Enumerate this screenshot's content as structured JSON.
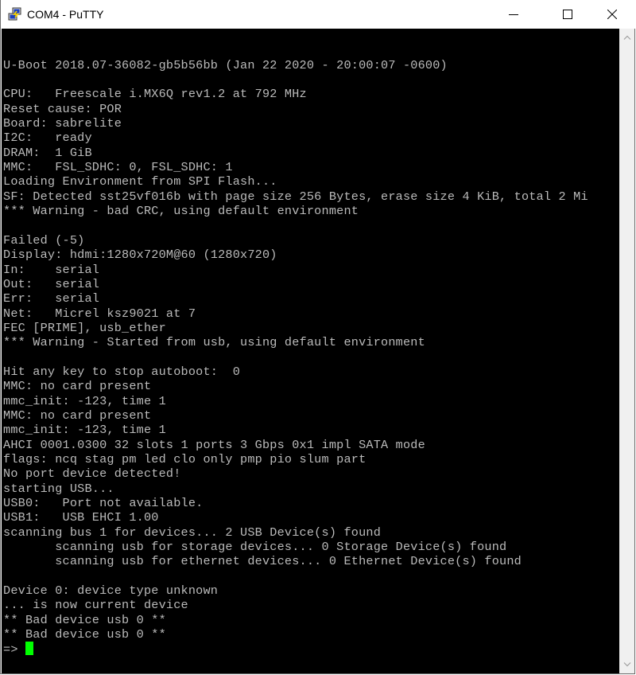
{
  "window": {
    "title": "COM4 - PuTTY",
    "app_icon": "putty-icon",
    "controls": {
      "minimize": "minimize-icon",
      "maximize": "maximize-icon",
      "close": "close-icon"
    }
  },
  "terminal": {
    "background": "#000000",
    "foreground": "#bbbbbb",
    "cursor_color": "#00ff00",
    "lines": [
      "",
      "",
      "U-Boot 2018.07-36082-gb5b56bb (Jan 22 2020 - 20:00:07 -0600)",
      "",
      "CPU:   Freescale i.MX6Q rev1.2 at 792 MHz",
      "Reset cause: POR",
      "Board: sabrelite",
      "I2C:   ready",
      "DRAM:  1 GiB",
      "MMC:   FSL_SDHC: 0, FSL_SDHC: 1",
      "Loading Environment from SPI Flash...",
      "SF: Detected sst25vf016b with page size 256 Bytes, erase size 4 KiB, total 2 Mi",
      "*** Warning - bad CRC, using default environment",
      "",
      "Failed (-5)",
      "Display: hdmi:1280x720M@60 (1280x720)",
      "In:    serial",
      "Out:   serial",
      "Err:   serial",
      "Net:   Micrel ksz9021 at 7",
      "FEC [PRIME], usb_ether",
      "*** Warning - Started from usb, using default environment",
      "",
      "Hit any key to stop autoboot:  0",
      "MMC: no card present",
      "mmc_init: -123, time 1",
      "MMC: no card present",
      "mmc_init: -123, time 1",
      "AHCI 0001.0300 32 slots 1 ports 3 Gbps 0x1 impl SATA mode",
      "flags: ncq stag pm led clo only pmp pio slum part",
      "No port device detected!",
      "starting USB...",
      "USB0:   Port not available.",
      "USB1:   USB EHCI 1.00",
      "scanning bus 1 for devices... 2 USB Device(s) found",
      "       scanning usb for storage devices... 0 Storage Device(s) found",
      "       scanning usb for ethernet devices... 0 Ethernet Device(s) found",
      "",
      "Device 0: device type unknown",
      "... is now current device",
      "** Bad device usb 0 **",
      "** Bad device usb 0 **"
    ],
    "prompt": "=> "
  },
  "scrollbar": {
    "up_icon": "chevron-up-icon",
    "down_icon": "chevron-down-icon"
  }
}
